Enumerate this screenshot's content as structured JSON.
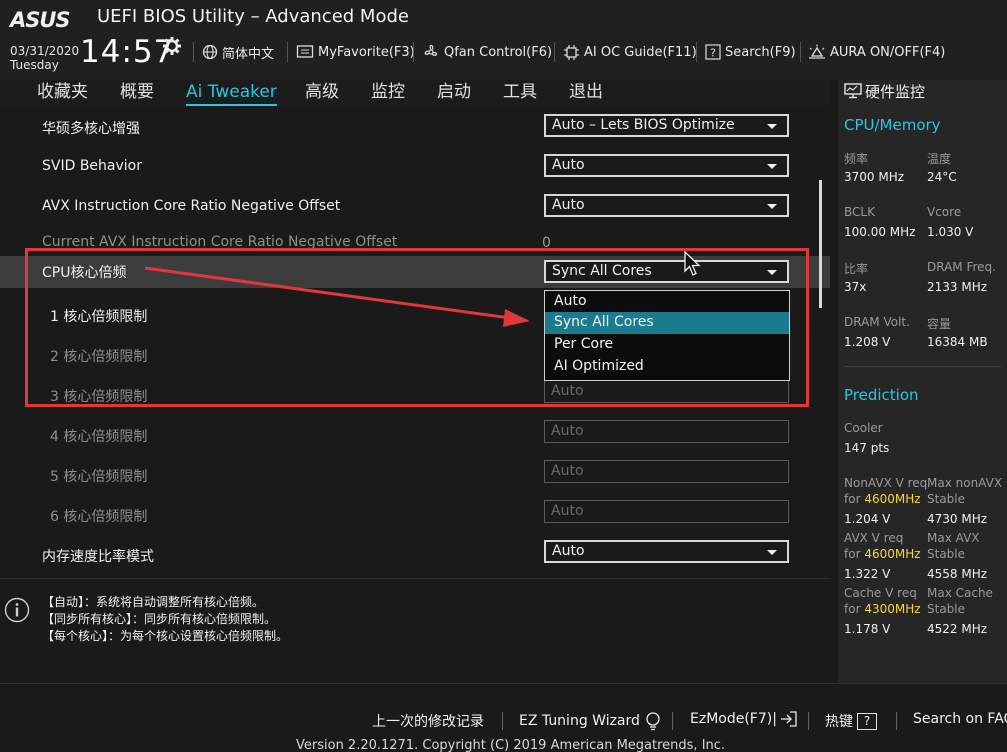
{
  "header": {
    "logo": "ASUS",
    "title": "UEFI BIOS Utility – Advanced Mode",
    "date": "03/31/2020",
    "day": "Tuesday",
    "time": "14:57",
    "buttons": [
      {
        "label": "简体中文",
        "icon": "globe-icon"
      },
      {
        "label": "MyFavorite(F3)",
        "icon": "favorite-icon"
      },
      {
        "label": "Qfan Control(F6)",
        "icon": "fan-icon"
      },
      {
        "label": "AI OC Guide(F11)",
        "icon": "chip-icon"
      },
      {
        "label": "Search(F9)",
        "icon": "question-icon"
      },
      {
        "label": "AURA ON/OFF(F4)",
        "icon": "aura-icon"
      }
    ]
  },
  "tabs": [
    {
      "label": "收藏夹"
    },
    {
      "label": "概要"
    },
    {
      "label": "Ai Tweaker",
      "active": true
    },
    {
      "label": "高级"
    },
    {
      "label": "监控"
    },
    {
      "label": "启动"
    },
    {
      "label": "工具"
    },
    {
      "label": "退出"
    }
  ],
  "settings": [
    {
      "label": "华硕多核心增强",
      "value": "Auto – Lets BIOS Optimize"
    },
    {
      "label": "SVID Behavior",
      "value": "Auto"
    },
    {
      "label": "AVX Instruction Core Ratio Negative Offset",
      "value": "Auto"
    },
    {
      "label": "Current AVX Instruction Core Ratio Negative Offset",
      "value": "0"
    },
    {
      "label": "CPU核心倍频",
      "value": "Sync All Cores"
    },
    {
      "label": "1 核心倍频限制",
      "value": ""
    },
    {
      "label": "2 核心倍频限制",
      "value": ""
    },
    {
      "label": "3 核心倍频限制",
      "value": "Auto"
    },
    {
      "label": "4 核心倍频限制",
      "value": "Auto"
    },
    {
      "label": "5 核心倍频限制",
      "value": "Auto"
    },
    {
      "label": "6 核心倍频限制",
      "value": "Auto"
    },
    {
      "label": "内存速度比率模式",
      "value": "Auto"
    }
  ],
  "dropdown": {
    "options": [
      "Auto",
      "Sync All Cores",
      "Per Core",
      "AI Optimized"
    ],
    "selected": "Sync All Cores"
  },
  "help": {
    "lines": [
      "【自动】：系统将自动调整所有核心倍频。",
      "【同步所有核心】：同步所有核心倍频限制。",
      "【每个核心】：为每个核心设置核心倍频限制。"
    ]
  },
  "hw_monitor": {
    "title": "硬件监控",
    "cpu_section": "CPU/Memory",
    "freq_label": "频率",
    "freq_value": "3700 MHz",
    "temp_label": "温度",
    "temp_value": "24°C",
    "bclk_label": "BCLK",
    "bclk_value": "100.00 MHz",
    "vcore_label": "Vcore",
    "vcore_value": "1.030 V",
    "ratio_label": "比率",
    "ratio_value": "37x",
    "dram_freq_label": "DRAM Freq.",
    "dram_freq_value": "2133 MHz",
    "dram_volt_label": "DRAM Volt.",
    "dram_volt_value": "1.208 V",
    "capacity_label": "容量",
    "capacity_value": "16384 MB",
    "prediction_section": "Prediction",
    "cooler_label": "Cooler",
    "cooler_value": "147 pts",
    "nonavx_label": "NonAVX V req",
    "nonavx_for": "for ",
    "nonavx_freq": "4600MHz",
    "nonavx_value": "1.204 V",
    "max_nonavx_label": "Max nonAVX",
    "max_nonavx_stable": "Stable",
    "max_nonavx_value": "4730 MHz",
    "avx_label": "AVX V req",
    "avx_for": "for ",
    "avx_freq": "4600MHz",
    "avx_value": "1.322 V",
    "max_avx_label": "Max AVX",
    "max_avx_stable": "Stable",
    "max_avx_value": "4558 MHz",
    "cache_label": "Cache V req",
    "cache_for": "for ",
    "cache_freq": "4300MHz",
    "cache_value": "1.178 V",
    "max_cache_label": "Max Cache",
    "max_cache_stable": "Stable",
    "max_cache_value": "4522 MHz"
  },
  "footer": {
    "last_modified": "上一次的修改记录",
    "ez_tuning": "EZ Tuning Wizard",
    "ezmode": "EzMode(F7)|",
    "hotkeys": "热键",
    "hotkey_symbol": "?",
    "search_faq": "Search on FAQ",
    "copyright": "Version 2.20.1271. Copyright (C) 2019 American Megatrends, Inc."
  },
  "colors": {
    "accent": "#2ac5e0",
    "highlight_text": "#f4d63a",
    "annotation_red": "#e0383a",
    "dropdown_selected": "#1a7d8f"
  }
}
